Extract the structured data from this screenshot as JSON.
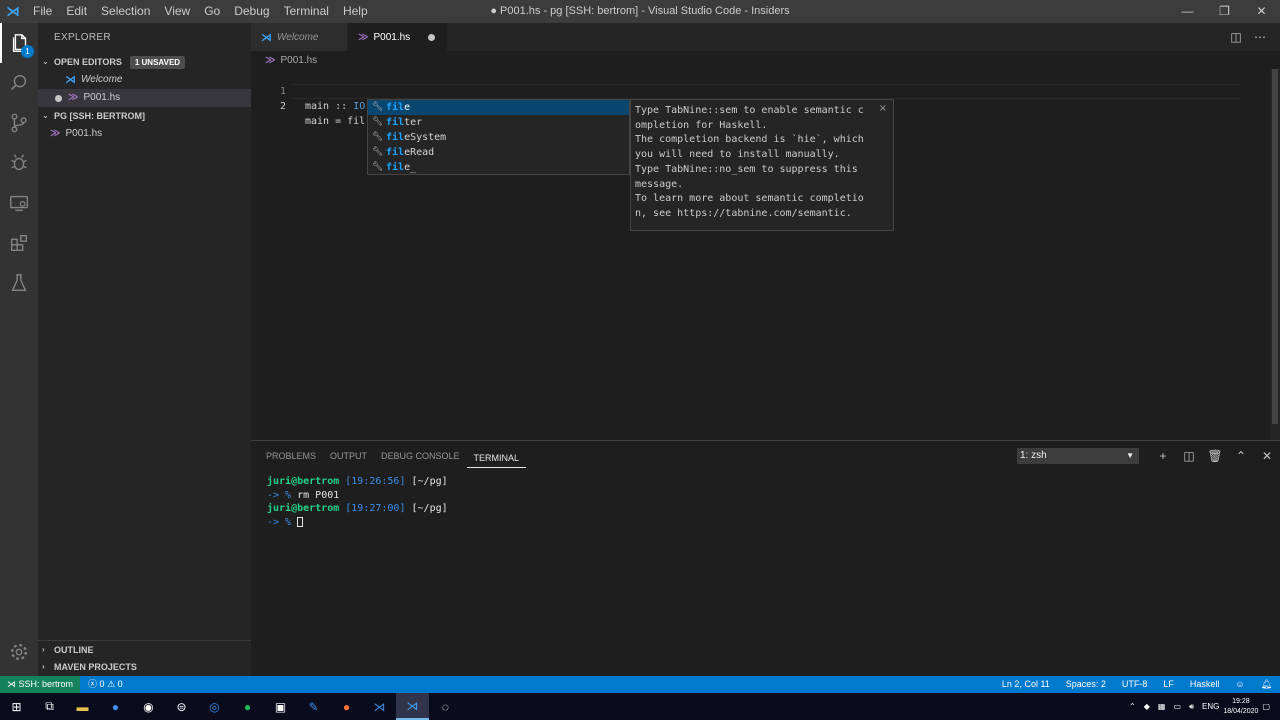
{
  "window": {
    "title": "● P001.hs - pg [SSH: bertrom] - Visual Studio Code - Insiders",
    "menu": [
      "File",
      "Edit",
      "Selection",
      "View",
      "Go",
      "Debug",
      "Terminal",
      "Help"
    ],
    "controls": {
      "minimize": "—",
      "maximize": "❐",
      "close": "✕"
    }
  },
  "activity": {
    "explorer_badge": "1"
  },
  "sidebar": {
    "title": "EXPLORER",
    "open_editors": {
      "label": "OPEN EDITORS",
      "badge": "1 UNSAVED"
    },
    "open_items": [
      {
        "label": "Welcome"
      },
      {
        "label": "P001.hs"
      }
    ],
    "folder": {
      "label": "PG [SSH: BERTROM]"
    },
    "folder_items": [
      {
        "label": "P001.hs"
      }
    ],
    "outline": "OUTLINE",
    "maven": "MAVEN PROJECTS"
  },
  "tabs": [
    {
      "label": "Welcome"
    },
    {
      "label": "P001.hs"
    }
  ],
  "breadcrumb": "P001.hs",
  "editor": {
    "lines": [
      {
        "num": "1",
        "a": "main",
        "b": " :: ",
        "c": "IO",
        "d": " ()"
      },
      {
        "num": "2",
        "text": "main = fil[1..999]"
      }
    ]
  },
  "suggest": {
    "items": [
      {
        "match": "fil",
        "rest": "e"
      },
      {
        "match": "fil",
        "rest": "ter"
      },
      {
        "match": "fil",
        "rest": "eSystem"
      },
      {
        "match": "fil",
        "rest": "eRead"
      },
      {
        "match": "fil",
        "rest": "e_"
      }
    ],
    "doc": "Type TabNine::sem to enable semantic c\nompletion for Haskell.\nThe completion backend is `hie`, which\nyou will need to install manually.\nType TabNine::no_sem to suppress this\nmessage.\nTo learn more about semantic completio\nn, see https://tabnine.com/semantic.",
    "close": "×"
  },
  "panel": {
    "tabs": [
      "PROBLEMS",
      "OUTPUT",
      "DEBUG CONSOLE",
      "TERMINAL"
    ],
    "terminal_select": "1: zsh",
    "terminal": [
      {
        "user": "juri@bertrom",
        "time": " [19:26:56]",
        "dir": " [~/pg]"
      },
      {
        "prompt": "-> % ",
        "cmd": "rm P001"
      },
      {
        "user": "juri@bertrom",
        "time": " [19:27:00]",
        "dir": " [~/pg]"
      },
      {
        "prompt": "-> % ",
        "cmd": ""
      }
    ]
  },
  "status": {
    "remote": "SSH: bertrom",
    "errors": "0",
    "warnings": "0",
    "position": "Ln 2, Col 11",
    "spaces": "Spaces: 2",
    "encoding": "UTF-8",
    "eol": "LF",
    "language": "Haskell"
  },
  "taskbar": {
    "lang": "ENG",
    "time": "19:28",
    "date": "18/04/2020"
  }
}
